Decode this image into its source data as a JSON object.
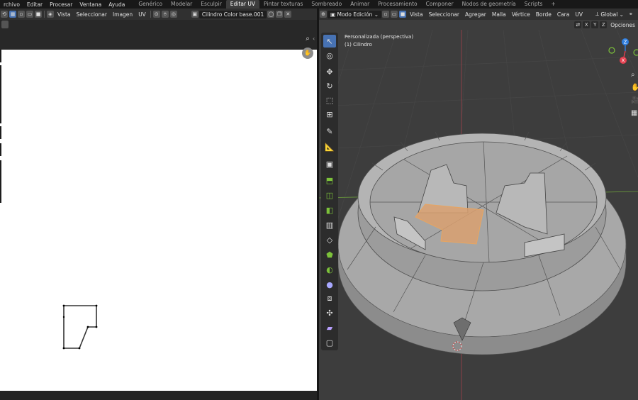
{
  "topbar": {
    "menus": [
      "rchivo",
      "Editar",
      "Procesar",
      "Ventana",
      "Ayuda"
    ],
    "workspaces": [
      "Genérico",
      "Modelar",
      "Esculpir",
      "Editar UV",
      "Pintar texturas",
      "Sombreado",
      "Animar",
      "Procesamiento",
      "Componer",
      "Nodos de geometría",
      "Scripts"
    ],
    "active_workspace": "Editar UV",
    "add_tab": "+"
  },
  "uv_editor": {
    "menus": [
      "Vista",
      "Seleccionar",
      "Imagen",
      "UV"
    ],
    "image_name": "Cilindro Color base.001"
  },
  "viewport": {
    "mode": "Modo Edición",
    "menus": [
      "Vista",
      "Seleccionar",
      "Agregar",
      "Malla",
      "Vértice",
      "Borde",
      "Cara",
      "UV"
    ],
    "transform_orientation": "Global",
    "axes": [
      "X",
      "Y",
      "Z"
    ],
    "options_label": "Opciones",
    "view_name": "Personalizada (perspectiva)",
    "object_name": "(1) Cilindro",
    "gizmo_labels": {
      "z": "Z",
      "x": "X"
    },
    "colors": {
      "selection": "#e0a062",
      "active_tool": "#4772b3",
      "x_axis": "#e43f4f",
      "y_axis": "#7cc13a",
      "z_axis": "#2f7fe0"
    }
  }
}
